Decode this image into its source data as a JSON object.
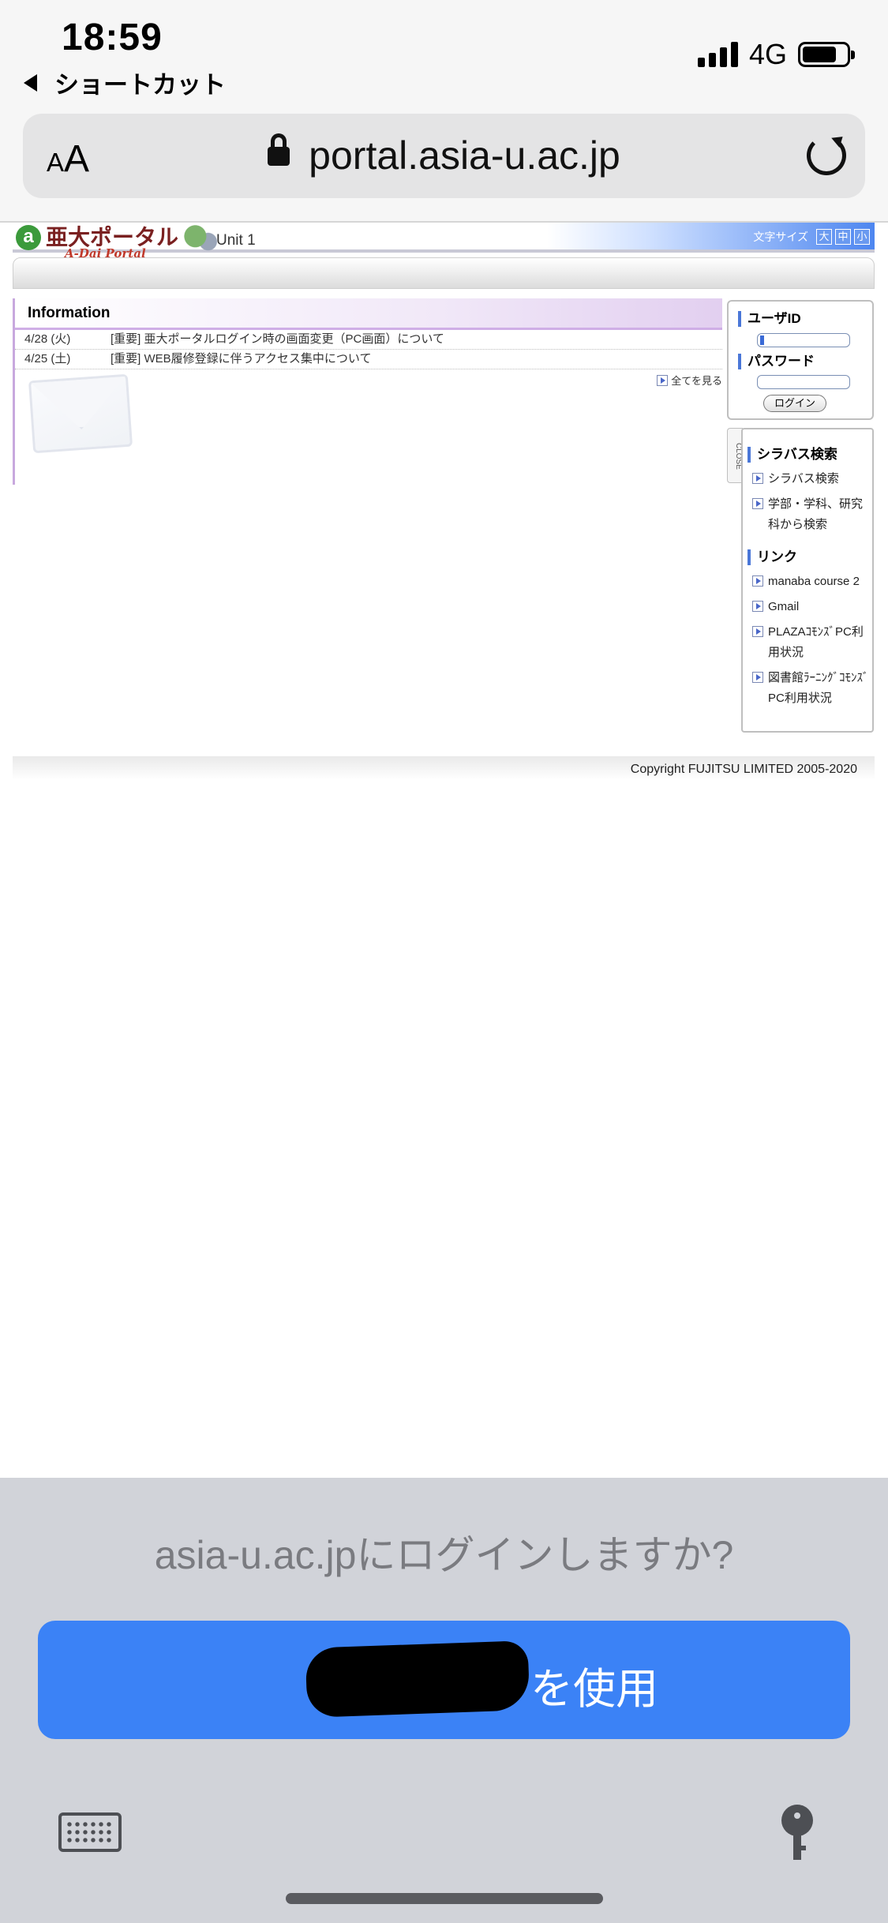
{
  "status_bar": {
    "time": "18:59",
    "back_label": "ショートカット",
    "network": "4G",
    "battery_level": 0.78
  },
  "browser": {
    "text_size_label": "AA",
    "url": "portal.asia-u.ac.jp"
  },
  "portal": {
    "logo_text": "亜大ポータル",
    "logo_sub": "A-Dai Portal",
    "unit": "Unit 1",
    "font_size": {
      "label": "文字サイズ",
      "large": "大",
      "medium": "中",
      "small": "小"
    },
    "information": {
      "title": "Information",
      "items": [
        {
          "date": "4/28 (火)",
          "text": "[重要] 亜大ポータルログイン時の画面変更（PC画面）について"
        },
        {
          "date": "4/25 (土)",
          "text": "[重要] WEB履修登録に伴うアクセス集中について"
        }
      ],
      "see_all": "全てを見る"
    },
    "login": {
      "user_id_label": "ユーザID",
      "password_label": "パスワード",
      "login_button": "ログイン"
    },
    "sidebar": {
      "close_label": "CLOSE",
      "syllabus_heading": "シラバス検索",
      "syllabus_links": [
        "シラバス検索",
        "学部・学科、研究科から検索"
      ],
      "links_heading": "リンク",
      "links": [
        "manaba course 2",
        "Gmail",
        "PLAZAｺﾓﾝｽﾞPC利用状況",
        "図書館ﾗｰﾆﾝｸﾞｺﾓﾝｽﾞPC利用状況"
      ]
    },
    "copyright": "Copyright FUJITSU LIMITED 2005-2020"
  },
  "password_sheet": {
    "prompt": "asia-u.ac.jpにログインしますか?",
    "use_suffix": "を使用"
  },
  "colors": {
    "accent_blue": "#3b82f6",
    "sheet_bg": "#d1d3d9"
  },
  "icons": [
    "lock-icon",
    "reload-icon",
    "keyboard-icon",
    "key-icon",
    "envelope-icon",
    "arrow-square-icon"
  ]
}
